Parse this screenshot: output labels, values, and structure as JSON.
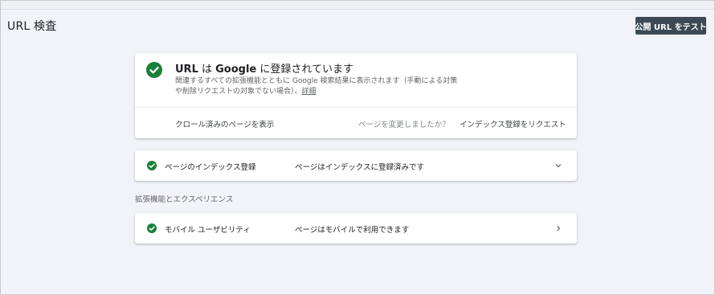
{
  "header": {
    "title": "URL 検査",
    "test_button_label": "公開 URL をテスト"
  },
  "status_card": {
    "title_part1": "URL",
    "title_part2": " は ",
    "title_part3": "Google",
    "title_part4": " に登録されています",
    "description": "関連するすべての拡張機能とともに Google 検索結果に表示されます（手動による対策や削除リクエストの対象でない場合）。",
    "details_link": "詳細",
    "crawl_view_label": "クロール済みのページを表示",
    "changed_question": "ページを変更しましたか？",
    "request_index_label": "インデックス登録をリクエスト"
  },
  "index_row": {
    "label": "ページのインデックス登録",
    "value": "ページはインデックスに登録済みです"
  },
  "enhancements": {
    "heading": "拡張機能とエクスペリエンス",
    "mobile_row": {
      "label": "モバイル ユーザビリティ",
      "value": "ページはモバイルで利用できます"
    }
  },
  "colors": {
    "success_green": "#188038",
    "button_dark": "#3d4a55",
    "page_background": "#f1f3f9"
  },
  "icons": {
    "status": "check-circle-icon",
    "expand": "chevron-down-icon",
    "navigate": "chevron-right-icon"
  }
}
